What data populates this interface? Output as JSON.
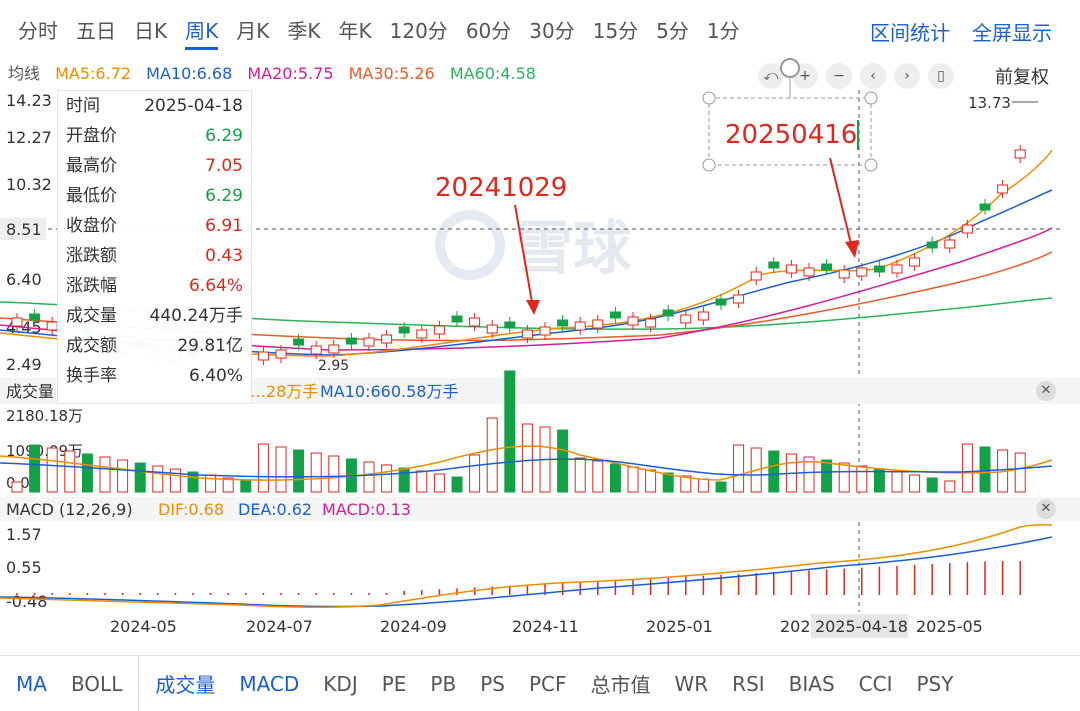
{
  "period_tabs": [
    "分时",
    "五日",
    "日K",
    "周K",
    "月K",
    "季K",
    "年K",
    "120分",
    "60分",
    "30分",
    "15分",
    "5分",
    "1分"
  ],
  "active_tab": "周K",
  "right_links": {
    "interval_stats": "区间统计",
    "fullscreen": "全屏显示"
  },
  "ma_legend": {
    "label": "均线",
    "items": [
      {
        "text": "MA5:6.72",
        "color": "#f08c00"
      },
      {
        "text": "MA10:6.68",
        "color": "#1b5fd6"
      },
      {
        "text": "MA20:5.75",
        "color": "#d81b9b"
      },
      {
        "text": "MA30:5.26",
        "color": "#f05a28"
      },
      {
        "text": "MA60:4.58",
        "color": "#2bb35a"
      }
    ]
  },
  "toolbar": {
    "undo": "⤺",
    "plus": "+",
    "minus": "−",
    "left": "‹",
    "right": "›",
    "candle": "▯",
    "adjust_label": "前复权"
  },
  "price_axis": [
    "14.23",
    "12.27",
    "10.32",
    "8.51",
    "6.40",
    "4.45",
    "2.49"
  ],
  "crosshair_price": "8.51",
  "price_annotations": {
    "high": "13.73",
    "low": "2.95"
  },
  "annotations": {
    "a1": "20241029",
    "a2": "20250416"
  },
  "watermark": "雪球",
  "tooltip": [
    {
      "k": "时间",
      "v": "2025-04-18",
      "c": "dark"
    },
    {
      "k": "开盘价",
      "v": "6.29",
      "c": "green"
    },
    {
      "k": "最高价",
      "v": "7.05",
      "c": "red"
    },
    {
      "k": "最低价",
      "v": "6.29",
      "c": "green"
    },
    {
      "k": "收盘价",
      "v": "6.91",
      "c": "red"
    },
    {
      "k": "涨跌额",
      "v": "0.43",
      "c": "red"
    },
    {
      "k": "涨跌幅",
      "v": "6.64%",
      "c": "red"
    },
    {
      "k": "成交量",
      "v": "440.24万手",
      "c": "dark"
    },
    {
      "k": "成交额",
      "v": "29.81亿",
      "c": "dark"
    },
    {
      "k": "换手率",
      "v": "6.40%",
      "c": "dark"
    }
  ],
  "volume": {
    "header": "成交量",
    "ma5_text": "…28万手",
    "ma10_text": "MA10:660.58万手",
    "axis": [
      "2180.18万",
      "1090.09万",
      "0.00"
    ]
  },
  "macd": {
    "header": "MACD (12,26,9)",
    "dif": "DIF:0.68",
    "dea": "DEA:0.62",
    "macd": "MACD:0.13",
    "axis": [
      "1.57",
      "0.55",
      "-0.48"
    ]
  },
  "date_axis": [
    "2024-05",
    "2024-07",
    "2024-09",
    "2024-11",
    "2025-01",
    "202",
    "2025-05"
  ],
  "crosshair_date": "2025-04-18",
  "bottom_tabs": [
    "MA",
    "BOLL",
    "成交量",
    "MACD",
    "KDJ",
    "PE",
    "PB",
    "PS",
    "PCF",
    "总市值",
    "WR",
    "RSI",
    "BIAS",
    "CCI",
    "PSY"
  ],
  "colors": {
    "up": "#e0261d",
    "down": "#14a046",
    "accent": "#1b5fd6"
  }
}
